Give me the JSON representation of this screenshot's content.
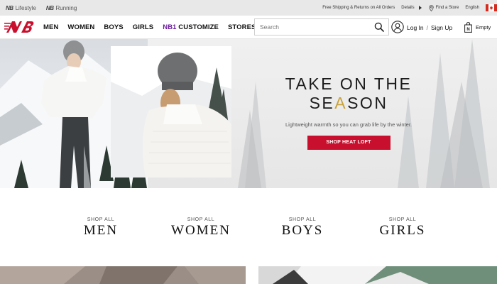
{
  "utility_bar": {
    "brand_links": [
      {
        "logo_text": "NB",
        "label": "Lifestyle"
      },
      {
        "logo_text": "NB",
        "label": "Running"
      }
    ],
    "shipping_text": "Free Shipping & Returns on All Orders",
    "details_label": "Details",
    "find_store_label": "Find a Store",
    "language_label": "English"
  },
  "header": {
    "nav": [
      {
        "label": "MEN"
      },
      {
        "label": "WOMEN"
      },
      {
        "label": "BOYS"
      },
      {
        "label": "GIRLS"
      },
      {
        "label": "NB1 CUSTOMIZE"
      },
      {
        "label": "STORES"
      }
    ],
    "nb1_tag": "NB1",
    "nb1_rest": " CUSTOMIZE",
    "search_placeholder": "Search",
    "login_label": "Log In",
    "separator": "/",
    "signup_label": "Sign Up",
    "cart_label": "Empty"
  },
  "hero": {
    "title_line1": "TAKE ON THE",
    "title_line2_pre": "SE",
    "title_line2_accent": "A",
    "title_line2_post": "SON",
    "subtitle": "Lightweight warmth so you can grab life by the winter.",
    "cta_label": "SHOP HEAT LOFT"
  },
  "categories": [
    {
      "small": "SHOP ALL",
      "big": "MEN"
    },
    {
      "small": "SHOP ALL",
      "big": "WOMEN"
    },
    {
      "small": "SHOP ALL",
      "big": "BOYS"
    },
    {
      "small": "SHOP ALL",
      "big": "GIRLS"
    }
  ],
  "colors": {
    "brand_red": "#c8102e",
    "accent_gold": "#c9a23a",
    "nb1_purple": "#6a1b9a",
    "utility_bar_bg": "#e8e8e8"
  },
  "icons": {
    "search": "search-icon",
    "user": "user-icon",
    "cart": "shopping-bag-icon",
    "store": "map-pin-icon",
    "flag": "canada-flag-icon"
  }
}
